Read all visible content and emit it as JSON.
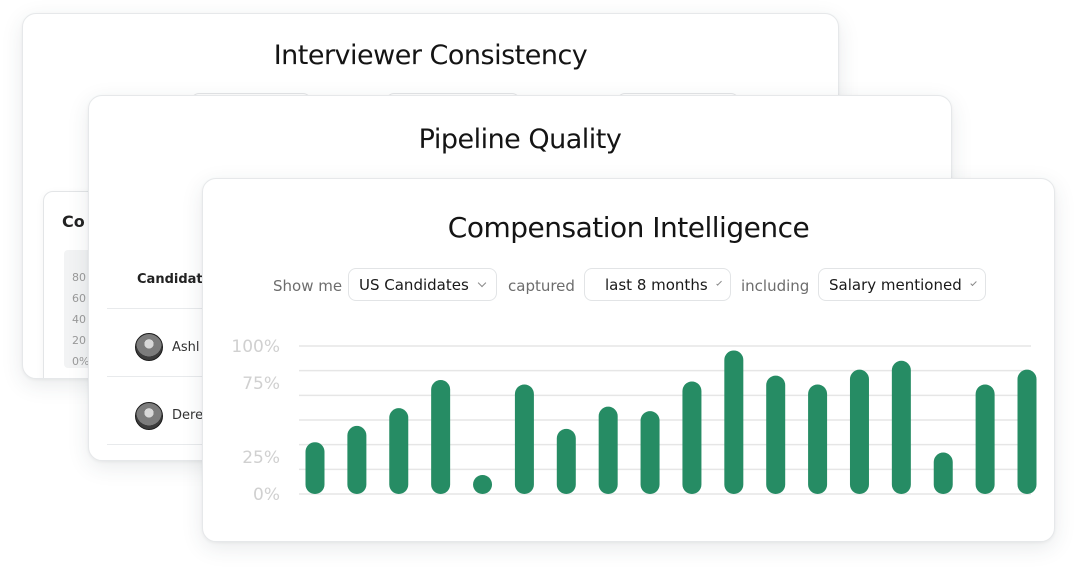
{
  "cards": {
    "interviewer": {
      "title": "Interviewer Consistency",
      "panel_title": "Co",
      "ticks": [
        "80",
        "60",
        "40",
        "20",
        "0%"
      ]
    },
    "pipeline": {
      "title": "Pipeline Quality",
      "column_header": "Candidate",
      "rows": [
        {
          "name": "Ashl"
        },
        {
          "name": "Dere"
        }
      ]
    },
    "compensation": {
      "title": "Compensation Intelligence",
      "filters": {
        "show_me_label": "Show me",
        "audience": "US Candidates",
        "captured_label": "captured",
        "period": "last 8 months",
        "including_label": "including",
        "topic": "Salary mentioned"
      }
    }
  },
  "colors": {
    "bar": "#268c64",
    "grid": "#e6e6e6",
    "tick": "#d0d0d0"
  },
  "chart_data": {
    "type": "bar",
    "ylim": [
      0,
      100
    ],
    "y_ticks": [
      "100%",
      "75%",
      "25%",
      "0%"
    ],
    "grid": true,
    "series": [
      {
        "values": [
          35,
          46,
          58,
          77,
          6,
          74,
          44,
          59,
          56,
          76,
          97,
          80,
          74,
          84,
          90,
          28,
          74,
          84
        ]
      }
    ]
  }
}
